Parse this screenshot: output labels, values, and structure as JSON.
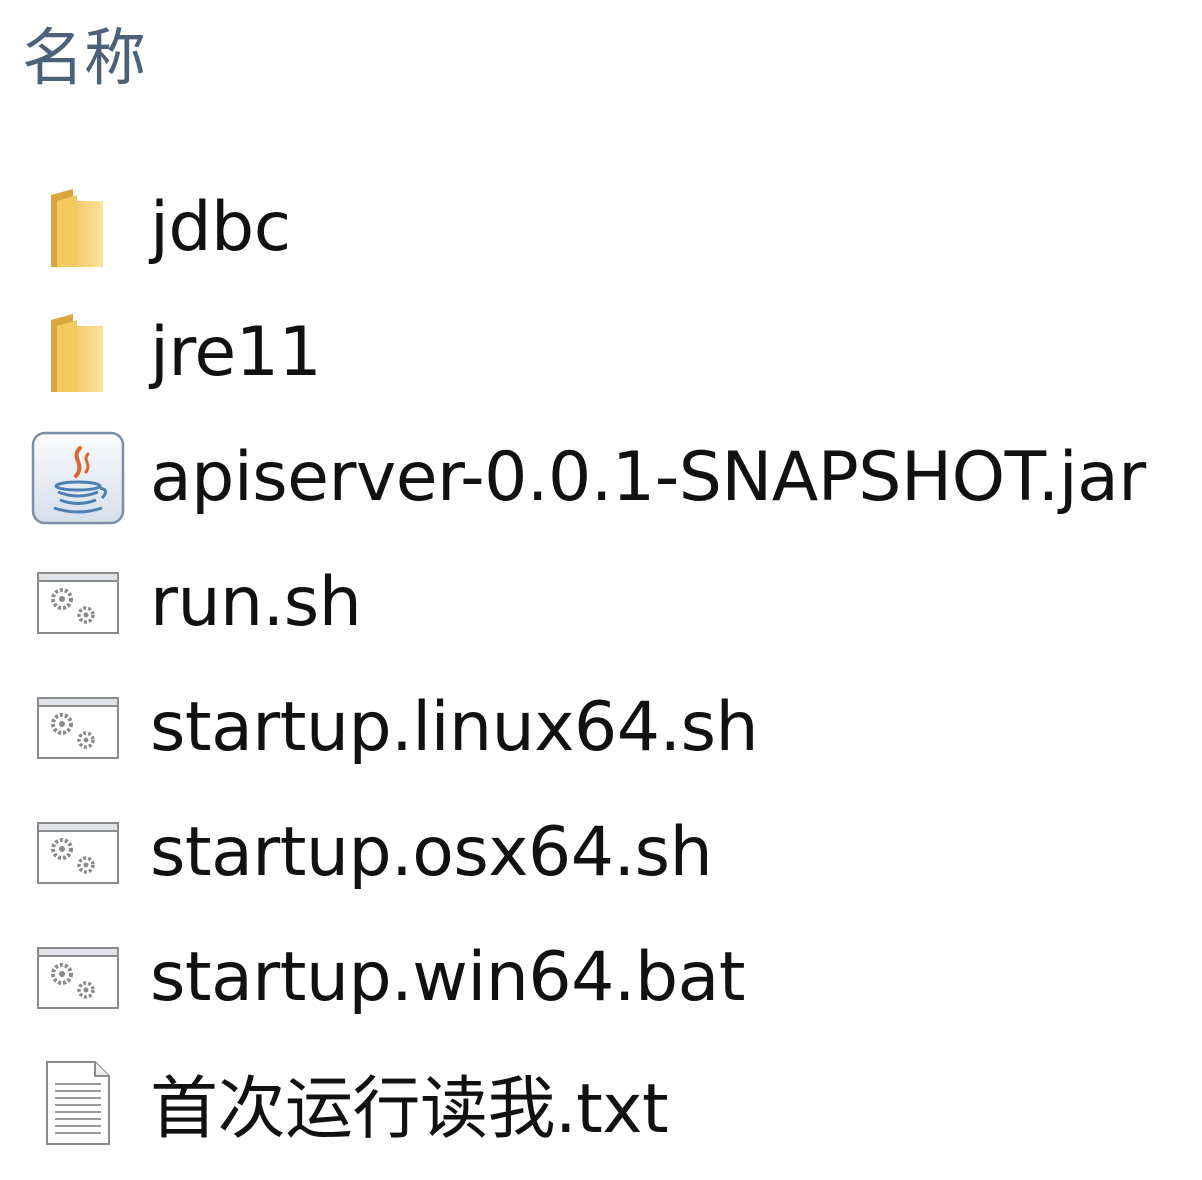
{
  "header": {
    "name_column": "名称"
  },
  "files": [
    {
      "name": "jdbc",
      "icon": "folder-icon"
    },
    {
      "name": "jre11",
      "icon": "folder-icon"
    },
    {
      "name": "apiserver-0.0.1-SNAPSHOT.jar",
      "icon": "java-jar-icon"
    },
    {
      "name": "run.sh",
      "icon": "script-gear-icon"
    },
    {
      "name": "startup.linux64.sh",
      "icon": "script-gear-icon"
    },
    {
      "name": "startup.osx64.sh",
      "icon": "script-gear-icon"
    },
    {
      "name": "startup.win64.bat",
      "icon": "script-gear-icon"
    },
    {
      "name": "首次运行读我.txt",
      "icon": "text-file-icon"
    }
  ],
  "colors": {
    "header_text": "#4c607a",
    "folder_yellow": "#f6d66f",
    "file_text": "#111111"
  }
}
